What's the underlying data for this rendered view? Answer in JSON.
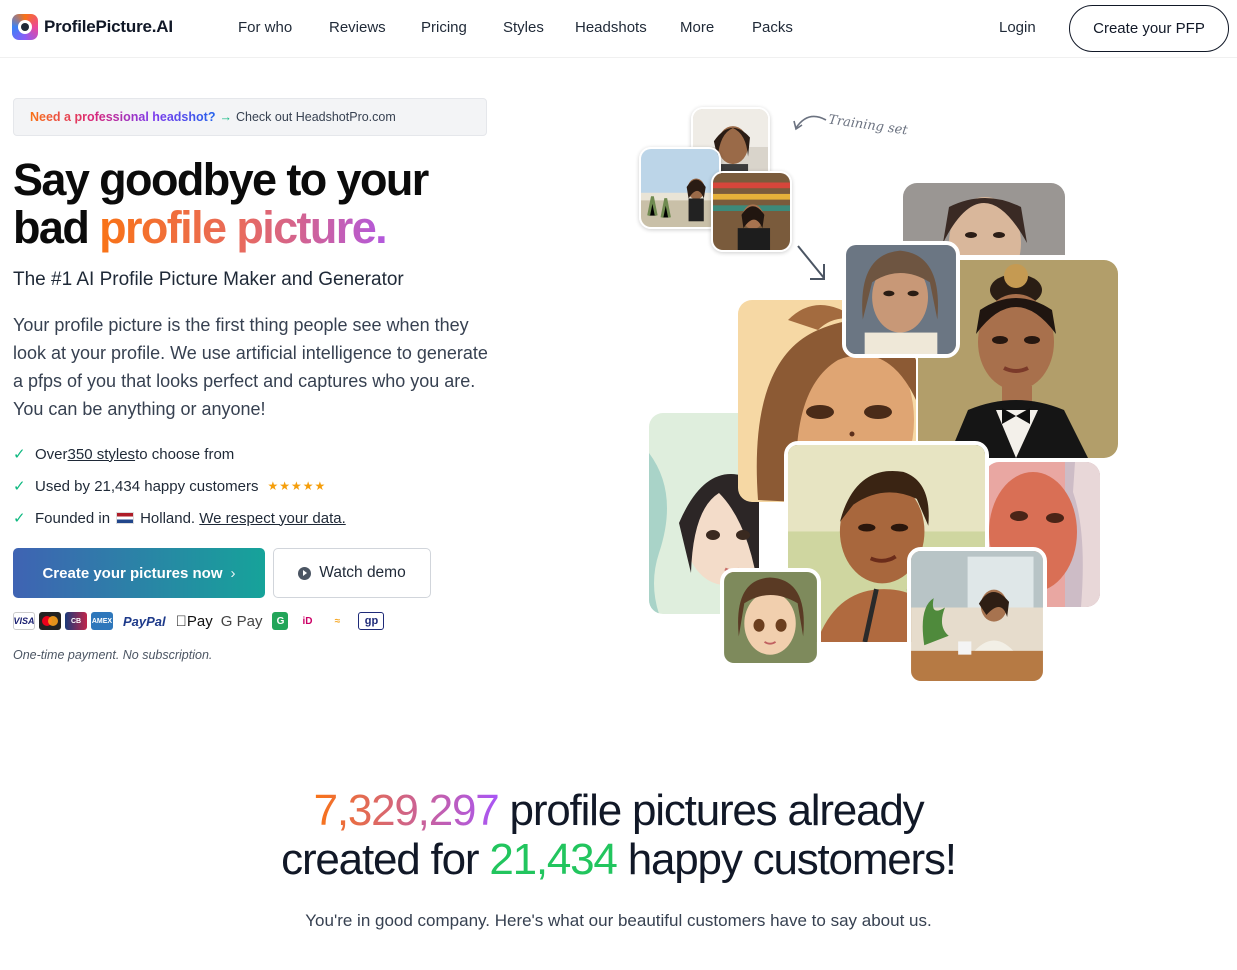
{
  "nav": {
    "brand": "ProfilePicture.AI",
    "links": [
      "For who",
      "Reviews",
      "Pricing",
      "Styles",
      "Headshots",
      "More",
      "Packs"
    ],
    "login": "Login",
    "cta": "Create your PFP"
  },
  "promo": {
    "lead": "Need a professional headshot?",
    "arrow": "→",
    "link": "Check out HeadshotPro.com"
  },
  "hero": {
    "headline_line1": "Say goodbye to your",
    "headline_line2_plain": "bad ",
    "headline_line2_accent": "profile picture.",
    "subhead": "The #1 AI Profile Picture Maker and Generator",
    "lead": "Your profile picture is the first thing people see when they look at your profile. We use artificial intelligence to generate a pfps of you that looks perfect and captures who you are. You can be anything or anyone!",
    "bullets": {
      "styles_pre": "Over ",
      "styles_link": "350 styles ",
      "styles_post": "to choose from",
      "customers": "Used by 21,434 happy customers",
      "stars": "★★★★★",
      "founded_pre": "Founded in",
      "founded_country": "Holland.",
      "founded_link": "We respect your data."
    },
    "cta_primary": "Create your pictures now",
    "cta_primary_chevron": "›",
    "cta_secondary": "Watch demo",
    "payments": {
      "visa": "VISA",
      "cb": "CB",
      "amex": "AMEX",
      "paypal": "PayPal",
      "applepay": "Pay",
      "gpay": "G Pay",
      "g": "G",
      "ideal": "iD",
      "bancontact": "≈",
      "gp": "gp"
    },
    "payment_note": "One-time payment. No subscription."
  },
  "collage": {
    "training_label": "Training set"
  },
  "stats": {
    "count_pictures": "7,329,297",
    "line1_rest": " profile pictures already",
    "line2_pre": "created for ",
    "count_customers": "21,434",
    "line2_post": " happy customers!",
    "subtitle": "You're in good company. Here's what our beautiful customers have to say about us."
  }
}
